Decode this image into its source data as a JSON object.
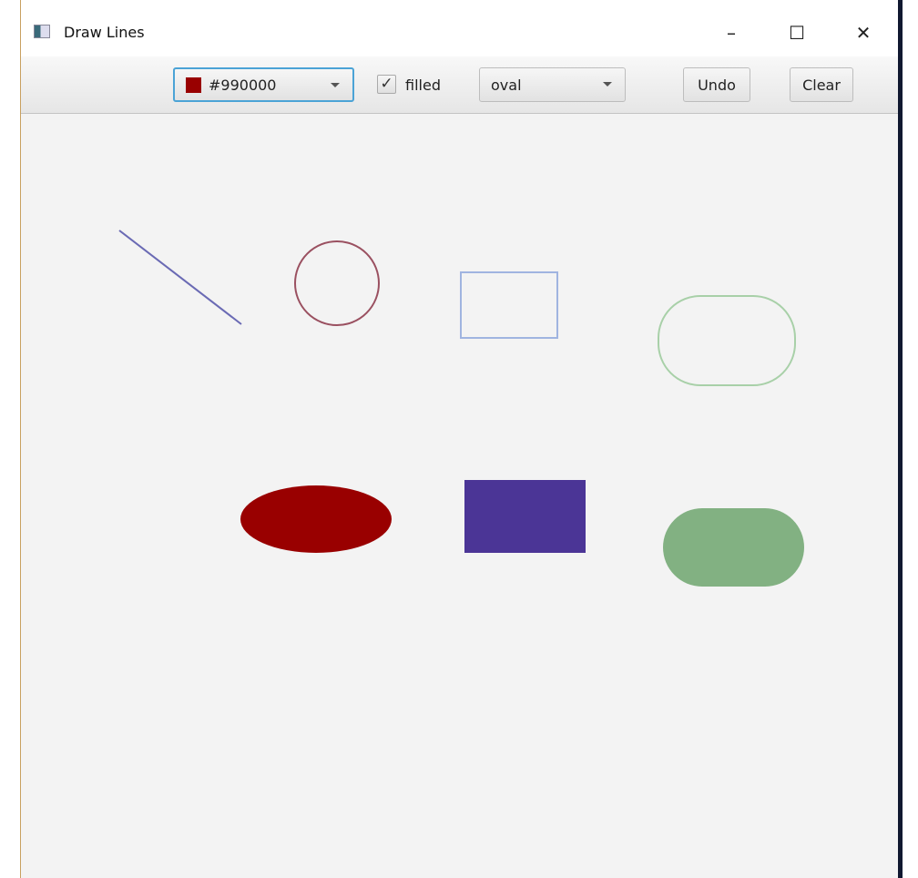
{
  "window": {
    "title": "Draw Lines"
  },
  "toolbar": {
    "color_value": "#990000",
    "color_swatch": "#990000",
    "filled_label": "filled",
    "filled_checked": true,
    "check_mark": "✓",
    "shape_value": "oval",
    "undo_label": "Undo",
    "clear_label": "Clear"
  },
  "window_controls": {
    "minimize": "–",
    "maximize": "☐",
    "close": "✕"
  },
  "shapes": [
    {
      "type": "line",
      "color": "#6a6ab4",
      "filled": false
    },
    {
      "type": "oval",
      "color": "#9a5060",
      "filled": false
    },
    {
      "type": "rectangle",
      "color": "#a0b4e0",
      "filled": false
    },
    {
      "type": "rounded-rectangle",
      "color": "#a8d0a8",
      "filled": false
    },
    {
      "type": "oval",
      "color": "#990000",
      "filled": true
    },
    {
      "type": "rectangle",
      "color": "#4b3596",
      "filled": true
    },
    {
      "type": "rounded-rectangle",
      "color": "#82b182",
      "filled": true
    }
  ]
}
